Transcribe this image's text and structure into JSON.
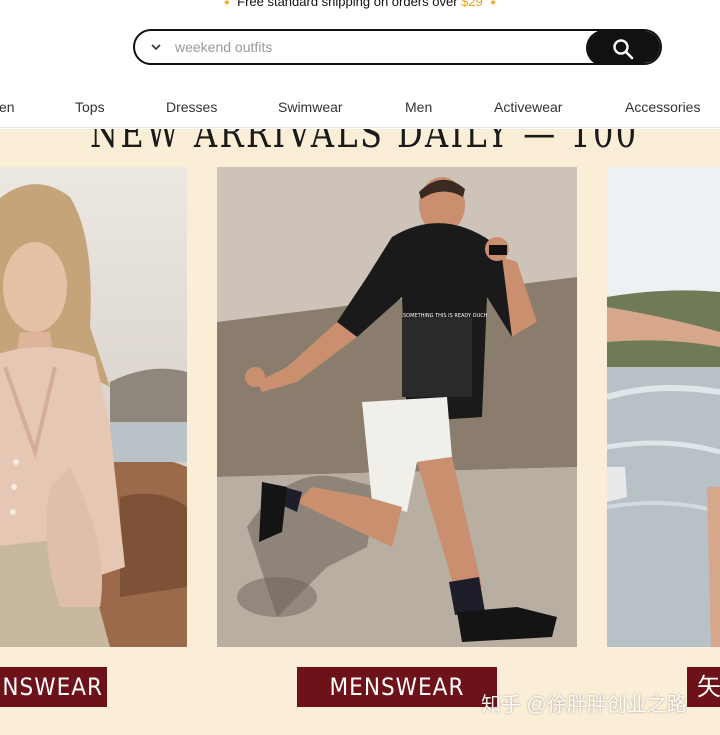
{
  "shipping": {
    "text": "Free standard shipping on orders over",
    "amount": "$29",
    "star": "✦"
  },
  "search": {
    "placeholder": "weekend outfits"
  },
  "nav": {
    "items": [
      {
        "label": "en"
      },
      {
        "label": "Tops"
      },
      {
        "label": "Dresses"
      },
      {
        "label": "Swimwear"
      },
      {
        "label": "Men"
      },
      {
        "label": "Activewear"
      },
      {
        "label": "Accessories"
      }
    ]
  },
  "promo": {
    "headline": "NEW ARRIVALS DAILY — 100",
    "cards": [
      {
        "label": "NSWEAR"
      },
      {
        "label": "MENSWEAR"
      },
      {
        "label": "矢"
      }
    ],
    "shirt_print": "SOMETHING THIS IS READY OUCH"
  },
  "watermark": "知乎 @徐胖胖创业之路",
  "colors": {
    "accent": "#f4a21f",
    "label_bg": "#6e1219",
    "promo_bg": "#fbeed6"
  }
}
